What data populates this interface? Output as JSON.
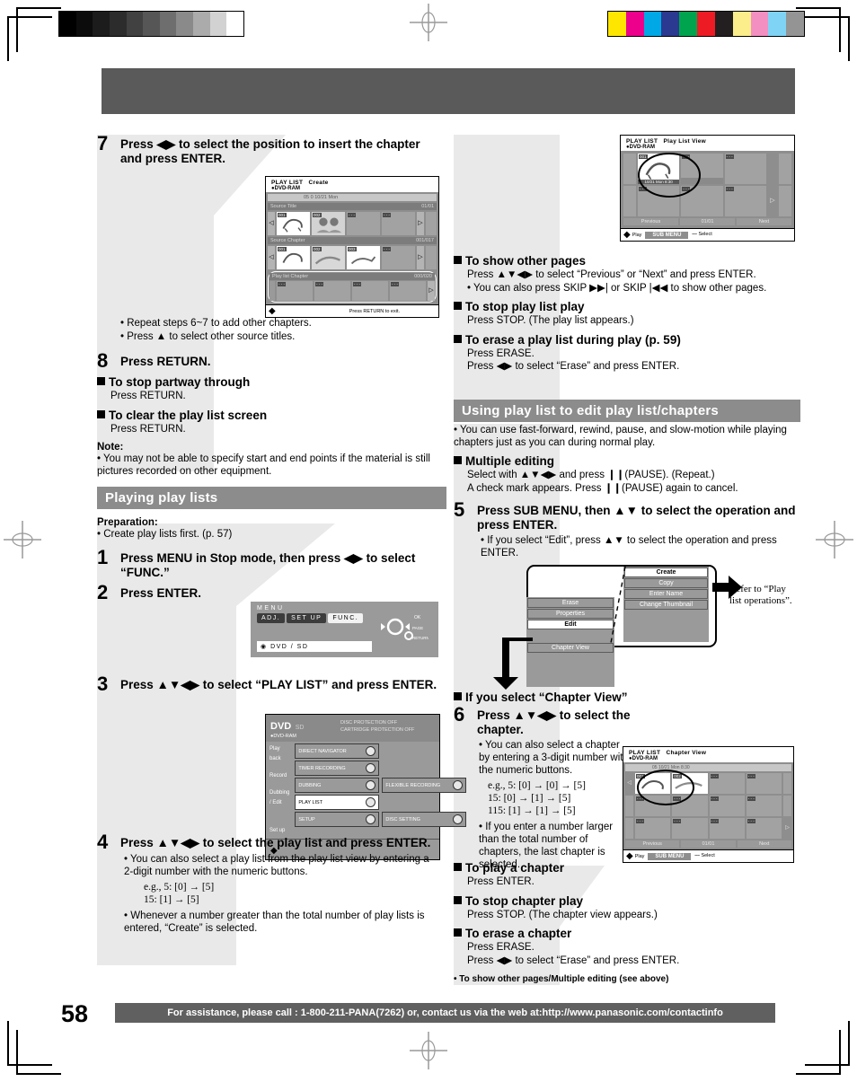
{
  "page": {
    "number": "58",
    "footer_text": "For assistance, please call : 1-800-211-PANA(7262) or, contact us via the web at:http://www.panasonic.com/contactinfo"
  },
  "calibration": {
    "gray_wedge": [
      "#000000",
      "#0c0c0c",
      "#1c1c1c",
      "#2c2c2c",
      "#414141",
      "#565656",
      "#6e6e6e",
      "#8a8a8a",
      "#ababab",
      "#d2d2d2",
      "#ffffff"
    ],
    "color_bar": [
      "#ffe600",
      "#ec008c",
      "#00a9e6",
      "#2b3990",
      "#00a44f",
      "#ed1c24",
      "#231f20",
      "#fbee8b",
      "#f48fc1",
      "#7fd4f5",
      "#949494"
    ]
  },
  "left_column": {
    "step7": {
      "number": "7",
      "text": "Press ◀▶ to select the position to insert the chapter and press ENTER.",
      "bullets": [
        "• Repeat steps 6~7 to add other chapters.",
        "• Press ▲ to select other source titles."
      ],
      "screen": {
        "title": "PLAY LIST",
        "mode": "Create",
        "disc": "DVD-RAM",
        "info_bar": "05       0   10/21  Mon",
        "row1_label": "Source Title",
        "row1_page": "01/01",
        "row2_label": "Source Chapter",
        "row2_page": "001/017",
        "row3_label": "Play list Chapter",
        "row3_page": "000/020",
        "hint": "Press RETURN to exit."
      }
    },
    "step8": {
      "number": "8",
      "text": "Press RETURN."
    },
    "blocks": [
      {
        "heading": "To stop partway through",
        "lines": [
          "Press RETURN."
        ]
      },
      {
        "heading": "To clear the play list screen",
        "lines": [
          "Press RETURN."
        ]
      }
    ],
    "note": {
      "heading": "Note:",
      "text": "• You may not be able to specify start and end points if the material is still pictures recorded on other equipment."
    },
    "section_title": "Playing play lists",
    "preparation": {
      "heading": "Preparation:",
      "text": "• Create play lists first. (p. 57)"
    },
    "step1": {
      "number": "1",
      "text": "Press MENU in Stop mode, then press ◀▶ to select “FUNC.”"
    },
    "step2": {
      "number": "2",
      "text": "Press ENTER."
    },
    "func_menu": {
      "title": "MENU",
      "tabs": [
        "ADJ.",
        "SET UP",
        "FUNC."
      ],
      "selected_tab": "FUNC.",
      "row": "DVD / SD",
      "pad_labels": [
        "OK",
        "PAGE",
        "RETURN"
      ]
    },
    "step3": {
      "number": "3",
      "text": "Press ▲▼◀▶ to select “PLAY LIST” and press ENTER.",
      "dvd_menu": {
        "disc_label": "DVD",
        "card_label": "SD",
        "disc_type": "DVD-RAM",
        "protection": [
          "DISC PROTECTION  OFF",
          "CARTRIDGE PROTECTION  OFF"
        ],
        "categories": [
          "Play back",
          "Record",
          "Dubbing / Edit",
          "Set up"
        ],
        "items": [
          {
            "label": "DIRECT NAVIGATOR",
            "icon": "grid-icon",
            "selected": false,
            "second": null
          },
          {
            "label": "TIMER RECORDING",
            "icon": "clock-icon",
            "selected": false,
            "second": null
          },
          {
            "label": "DUBBING",
            "icon": "disc-icon",
            "selected": false,
            "second": {
              "label": "FLEXIBLE RECORDING",
              "icon": "arrows-icon"
            }
          },
          {
            "label": "PLAY LIST",
            "icon": "playlist-icon",
            "selected": true,
            "second": null
          },
          {
            "label": "SETUP",
            "icon": "wrench-icon",
            "selected": false,
            "second": {
              "label": "DISC SETTING",
              "icon": "disc-icon"
            }
          }
        ]
      }
    },
    "step4": {
      "number": "4",
      "text": "Press ▲▼◀▶ to select the play list and press ENTER.",
      "bullets": [
        "• You can also select a play list from the play list view by entering a 2-digit number with the numeric buttons.",
        "• Whenever a number greater than the total number of play lists is entered, “Create” is selected."
      ],
      "examples": [
        "e.g.,  5:      [0] → [5]",
        "         15:      [1] → [5]"
      ]
    }
  },
  "right_column": {
    "playlist_screen": {
      "title": "PLAY LIST",
      "mode": "Play List View",
      "disc": "DVD-RAM",
      "thumb_label": "10/21  Mon   8:30",
      "footer": [
        "Previous",
        "01/01",
        "Next"
      ],
      "controls": {
        "play": "Play",
        "sub_menu": "SUB MENU",
        "select": "Select"
      }
    },
    "blocks_top": [
      {
        "heading": "To show other pages",
        "lines": [
          "Press ▲▼◀▶ to select “Previous” or “Next” and press ENTER.",
          "• You can also press SKIP ▶▶| or SKIP |◀◀ to show other pages."
        ]
      },
      {
        "heading": "To stop play list play",
        "lines": [
          "Press STOP. (The play list appears.)"
        ]
      },
      {
        "heading": "To erase a play list during play (p. 59)",
        "lines": [
          "Press ERASE.",
          "Press ◀▶ to select “Erase” and press ENTER."
        ]
      }
    ],
    "section_title": "Using play list to edit play list/chapters",
    "intro_bullet": "• You can use fast-forward, rewind, pause, and slow-motion while playing chapters just as you can during normal play.",
    "multiple_editing": {
      "heading": "Multiple editing",
      "lines": [
        "Select with ▲▼◀▶ and press ❙❙(PAUSE). (Repeat.)",
        "A check mark appears. Press ❙❙(PAUSE) again to cancel."
      ]
    },
    "step5": {
      "number": "5",
      "text": "Press SUB MENU, then ▲▼ to select the operation and press ENTER.",
      "bullet": "• If you select “Edit”, press ▲▼ to select the operation and press ENTER."
    },
    "flow": {
      "left_menu": [
        "Erase",
        "Properties",
        "Edit"
      ],
      "left_selected": "Edit",
      "right_menu": [
        "Create",
        "Copy",
        "Enter Name",
        "Change Thumbnail"
      ],
      "right_selected": "Create",
      "chapter_view": "Chapter View",
      "refer_text": "Refer to “Play list operations”."
    },
    "chapter_view_block": {
      "heading": "If you select “Chapter View”"
    },
    "step6": {
      "number": "6",
      "text": "Press ▲▼◀▶ to select the chapter.",
      "bullets": [
        "• You can also select a chapter by entering a 3-digit number with the numeric buttons.",
        "• If you enter a number larger than the total number of chapters, the last chapter is selected."
      ],
      "examples": [
        "e.g.,  5:      [0] → [0] → [5]",
        "         15:   [0] → [1] → [5]",
        "       115:   [1] → [1] → [5]"
      ],
      "screen": {
        "title": "PLAY LIST",
        "mode": "Chapter View",
        "disc": "DVD-RAM",
        "info_bar": "05      10/21  Mon   8:30",
        "footer": [
          "Previous",
          "01/01",
          "Next"
        ],
        "controls": {
          "play": "Play",
          "sub_menu": "SUB MENU",
          "select": "Select"
        }
      }
    },
    "blocks_bottom": [
      {
        "heading": "To play a chapter",
        "lines": [
          "Press ENTER."
        ]
      },
      {
        "heading": "To stop chapter play",
        "lines": [
          "Press STOP. (The chapter view appears.)"
        ]
      },
      {
        "heading": "To erase a chapter",
        "lines": [
          "Press ERASE.",
          "Press ◀▶ to select “Erase” and press ENTER."
        ]
      }
    ],
    "final_note": "• To show other pages/Multiple editing (see above)"
  }
}
